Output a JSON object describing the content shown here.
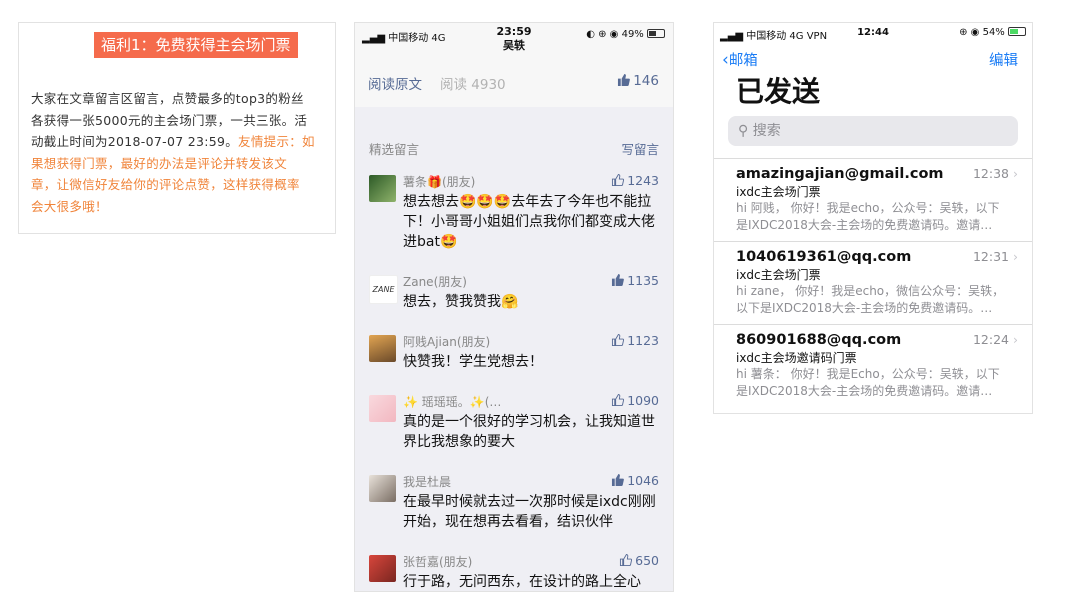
{
  "promo": {
    "title": "福利1：免费获得主会场门票",
    "line1": "大家在文章留言区留言，点赞最多的top3的粉丝",
    "line2": "各获得一张5000元的主会场门票，一共三张。活",
    "line3_plain": "动截止时间为2018-07-07 23:59。",
    "line3_tip": "友情提示：如",
    "line4": "果想获得门票，最好的办法是评论并转发该文",
    "line5": "章，让微信好友给你的评论点赞，这样获得概率",
    "line6": "会大很多哦！"
  },
  "wechat": {
    "status": {
      "carrier": "中国移动 4G",
      "time": "23:59",
      "contact": "吴轶",
      "battery": "49%"
    },
    "read_original": "阅读原文",
    "read_count": "阅读 4930",
    "article_likes": "146",
    "section_title": "精选留言",
    "write_comment": "写留言",
    "comments": [
      {
        "name": "薯条🎁(朋友)",
        "likes": "1243",
        "text": "想去想去🤩🤩🤩去年去了今年也不能拉下！小哥哥小姐姐们点我你们都变成大佬进bat🤩",
        "avatar": "#4f7d3f",
        "liked": false
      },
      {
        "name": "Zane(朋友)",
        "likes": "1135",
        "text": "想去，赞我赞我🤗",
        "avatar": "#ffffff",
        "liked": true
      },
      {
        "name": "阿贱Ajian(朋友)",
        "likes": "1123",
        "text": "快赞我！学生党想去！",
        "avatar": "#b07a3a",
        "liked": false
      },
      {
        "name": "✨ 瑶瑶瑶。✨(…",
        "likes": "1090",
        "text": "真的是一个很好的学习机会，让我知道世界比我想象的要大",
        "avatar": "#f4c9cf",
        "liked": false
      },
      {
        "name": "我是杜晨",
        "likes": "1046",
        "text": "在最早时候就去过一次那时候是ixdc刚刚开始，现在想再去看看，结识伙伴",
        "avatar": "#9a8f86",
        "liked": true
      },
      {
        "name": "张哲嘉(朋友)",
        "likes": "650",
        "text": "行于路，无问西东，在设计的路上全心",
        "avatar": "#b23a32",
        "liked": false
      }
    ]
  },
  "mail": {
    "status": {
      "carrier": "中国移动 4G VPN",
      "time": "12:44",
      "battery": "54%"
    },
    "back_label": "邮箱",
    "edit_label": "编辑",
    "title": "已发送",
    "search_placeholder": "搜索",
    "items": [
      {
        "from": "amazingajian@gmail.com",
        "time": "12:38",
        "subject": "ixdc主会场门票",
        "preview1": "hi 阿贱， 你好！我是echo，公众号：吴轶，以下",
        "preview2": "是IXDC2018大会-主会场的免费邀请码。邀请…"
      },
      {
        "from": "1040619361@qq.com",
        "time": "12:31",
        "subject": "ixdc主会场门票",
        "preview1": "hi zane， 你好！我是echo，微信公众号：吴轶，",
        "preview2": "以下是IXDC2018大会-主会场的免费邀请码。…"
      },
      {
        "from": "860901688@qq.com",
        "time": "12:24",
        "subject": "ixdc主会场邀请码门票",
        "preview1": "hi 薯条： 你好！我是Echo，公众号：吴轶，以下",
        "preview2": "是IXDC2018大会-主会场的免费邀请码。邀请…"
      }
    ]
  }
}
